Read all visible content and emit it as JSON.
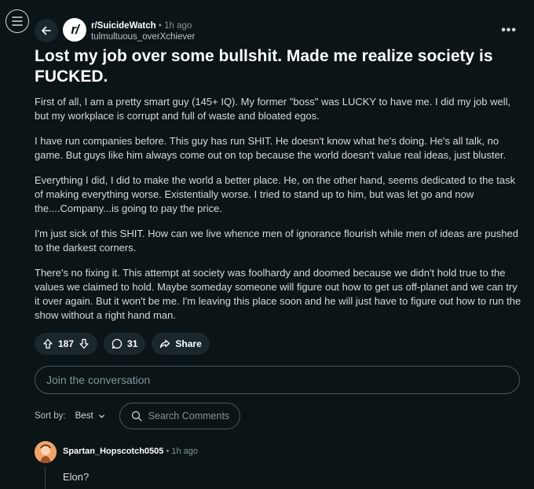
{
  "header": {
    "subreddit": "r/SuicideWatch",
    "separator": "•",
    "time": "1h ago",
    "username": "tulmultuous_overXchiever",
    "more": "•••"
  },
  "post": {
    "title": "Lost my job over some bullshit. Made me realize society is FUCKED.",
    "paragraphs": [
      "First of all, I am a pretty smart guy (145+ IQ). My former \"boss\" was LUCKY to have me. I did my job well, but my workplace is corrupt and full of waste and bloated egos.",
      "I have run companies before. This guy has run SHIT. He doesn't know what he's doing. He's all talk, no game. But guys like him always come out on top because the world doesn't value real ideas, just bluster.",
      "Everything I did, I did to make the world a better place. He, on the other hand, seems dedicated to the task of making everything worse. Existentially worse. I tried to stand up to him, but was let go and now the....Company...is going to pay the price.",
      "I'm just sick of this SHIT. How can we live whence men of ignorance flourish while men of ideas are pushed to the darkest corners.",
      "There's no fixing it. This attempt at society was foolhardy and doomed because we didn't hold true to the values we claimed to hold. Maybe someday someone will figure out how to get us off-planet and we can try it over again. But it won't be me. I'm leaving this place soon and he will just have to figure out how to run the show without a right hand man."
    ]
  },
  "actions": {
    "votes": "187",
    "comments": "31",
    "share": "Share"
  },
  "join": {
    "placeholder": "Join the conversation"
  },
  "sort": {
    "label": "Sort by:",
    "value": "Best",
    "search_placeholder": "Search Comments"
  },
  "comment": {
    "username": "Spartan_Hopscotch0505",
    "separator": "•",
    "time": "1h ago",
    "text": "Elon?"
  },
  "colors": {
    "background": "#0b1416",
    "pill": "#1a282d",
    "avatar": "#f0a368"
  }
}
